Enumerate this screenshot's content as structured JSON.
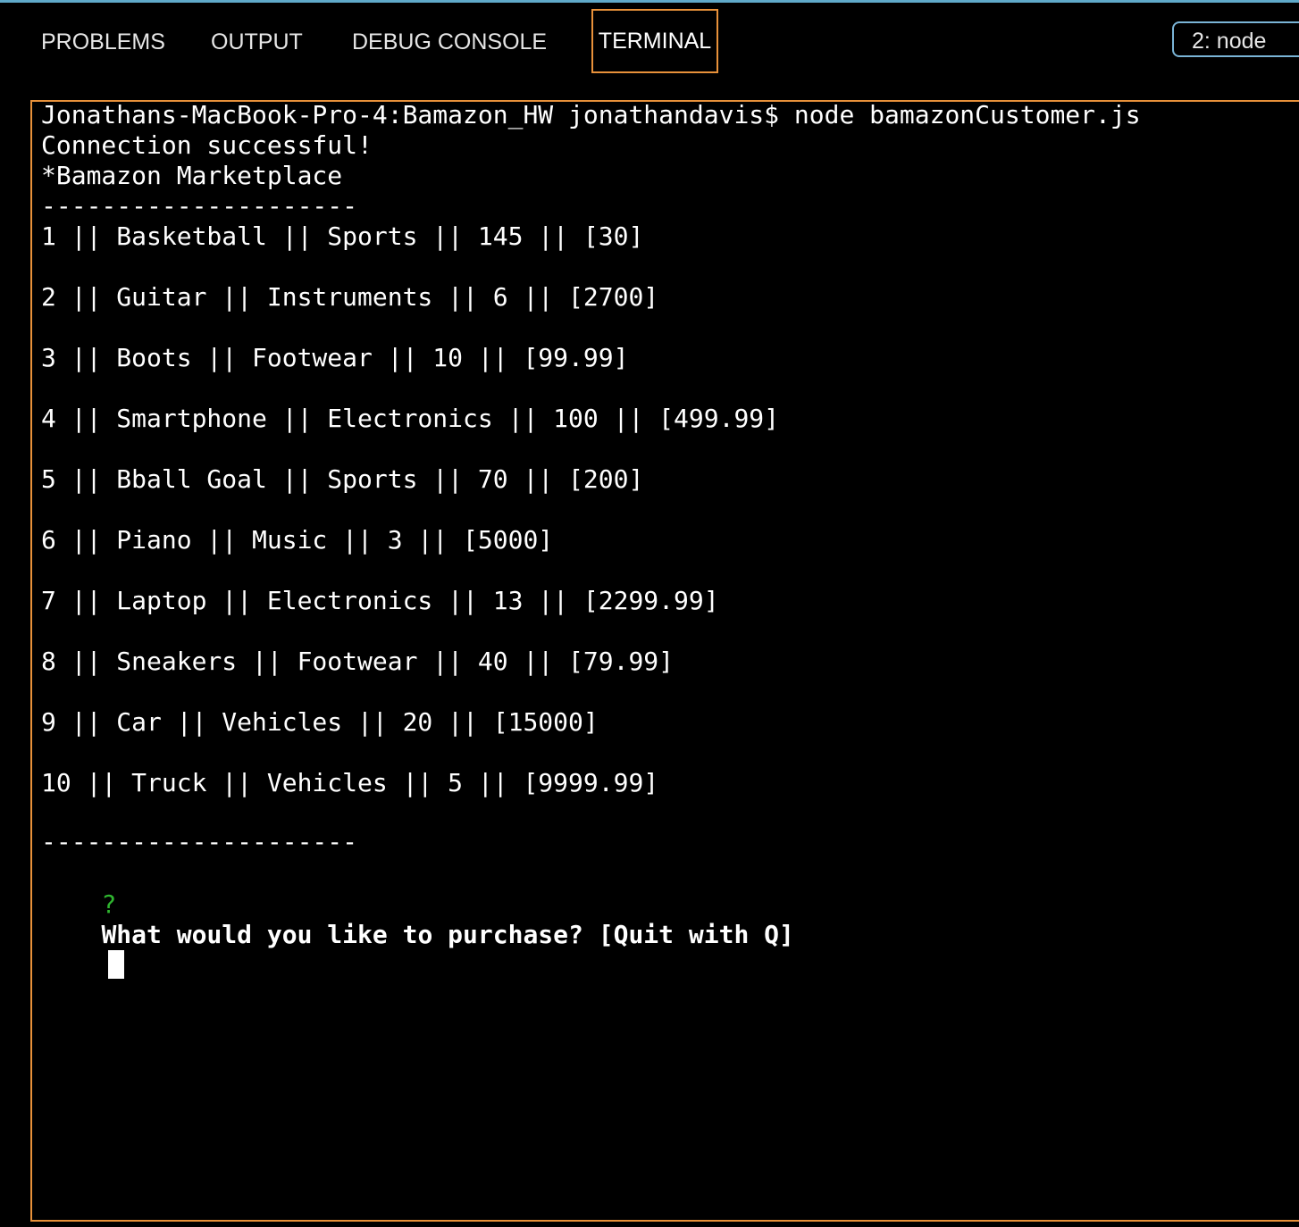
{
  "panel": {
    "tabs": {
      "problems": "PROBLEMS",
      "output": "OUTPUT",
      "debug_console": "DEBUG CONSOLE",
      "terminal": "TERMINAL"
    },
    "active_tab": "TERMINAL",
    "terminal_selector": "2: node",
    "accent_color": "#e8913a"
  },
  "terminal": {
    "command_line": "Jonathans-MacBook-Pro-4:Bamazon_HW jonathandavis$ node bamazonCustomer.js",
    "connection_message": "Connection successful!",
    "store_title": "*Bamazon Marketplace",
    "divider": "---------------------",
    "products": [
      "1 || Basketball || Sports || 145 || [30]",
      "2 || Guitar || Instruments || 6 || [2700]",
      "3 || Boots || Footwear || 10 || [99.99]",
      "4 || Smartphone || Electronics || 100 || [499.99]",
      "5 || Bball Goal || Sports || 70 || [200]",
      "6 || Piano || Music || 3 || [5000]",
      "7 || Laptop || Electronics || 13 || [2299.99]",
      "8 || Sneakers || Footwear || 40 || [79.99]",
      "9 || Car || Vehicles || 20 || [15000]",
      "10 || Truck || Vehicles || 5 || [9999.99]"
    ],
    "prompt_symbol": "?",
    "prompt_text": "What would you like to purchase? [Quit with Q]",
    "prompt_color": "#2fb52f"
  }
}
